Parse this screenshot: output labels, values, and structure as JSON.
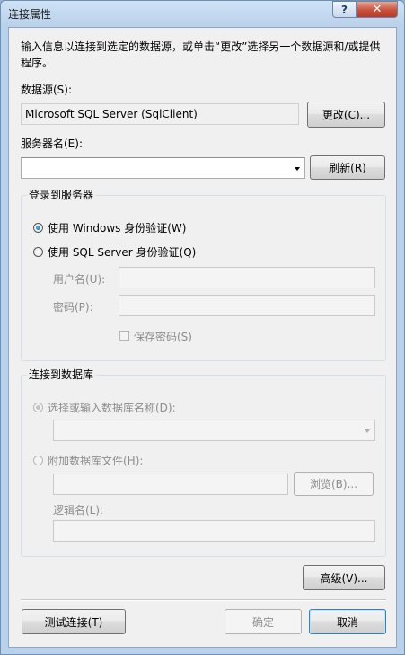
{
  "window": {
    "title": "连接属性"
  },
  "titlebar": {
    "help": "?",
    "close": "✕"
  },
  "instructions": "输入信息以连接到选定的数据源，或单击“更改”选择另一个数据源和/或提供程序。",
  "datasource": {
    "label": "数据源(S):",
    "value": "Microsoft SQL Server (SqlClient)",
    "change_button": "更改(C)..."
  },
  "server": {
    "label": "服务器名(E):",
    "value": "",
    "refresh_button": "刷新(R)"
  },
  "login": {
    "group_title": "登录到服务器",
    "windows_auth": {
      "label": "使用 Windows 身份验证(W)",
      "checked": true
    },
    "sql_auth": {
      "label": "使用 SQL Server 身份验证(Q)",
      "checked": false
    },
    "username_label": "用户名(U):",
    "username_value": "",
    "password_label": "密码(P):",
    "password_value": "",
    "save_password_label": "保存密码(S)"
  },
  "database": {
    "group_title": "连接到数据库",
    "select_db": {
      "label": "选择或输入数据库名称(D):",
      "checked": true,
      "value": ""
    },
    "attach_db": {
      "label": "附加数据库文件(H):",
      "checked": false,
      "value": ""
    },
    "browse_button": "浏览(B)...",
    "logical_name_label": "逻辑名(L):",
    "logical_name_value": ""
  },
  "buttons": {
    "advanced": "高级(V)...",
    "test": "测试连接(T)",
    "ok": "确定",
    "cancel": "取消"
  }
}
